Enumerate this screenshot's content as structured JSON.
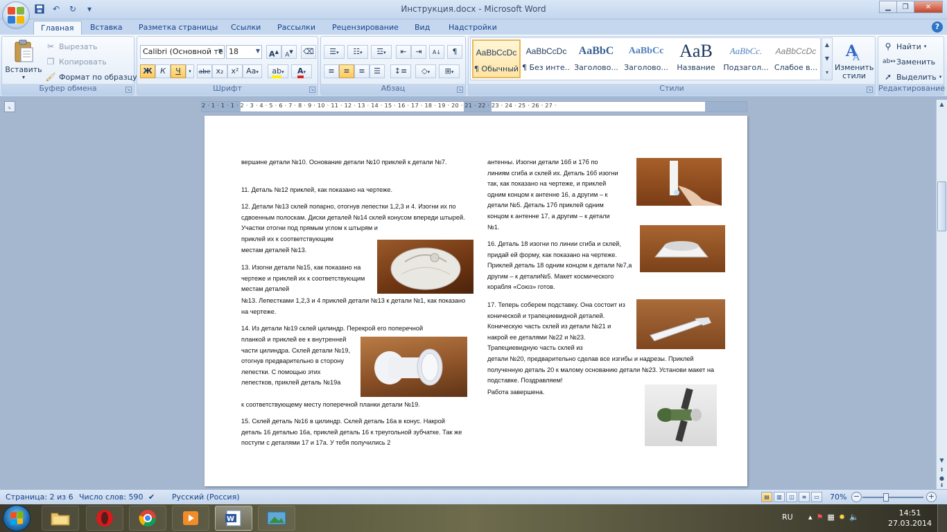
{
  "window": {
    "title": "Инструкция.docx - Microsoft Word"
  },
  "tabs": [
    "Главная",
    "Вставка",
    "Разметка страницы",
    "Ссылки",
    "Рассылки",
    "Рецензирование",
    "Вид",
    "Надстройки"
  ],
  "clipboard": {
    "paste": "Вставить",
    "cut": "Вырезать",
    "copy": "Копировать",
    "format_painter": "Формат по образцу",
    "label": "Буфер обмена"
  },
  "font": {
    "name": "Calibri (Основной те",
    "size": "18",
    "label": "Шрифт",
    "bold": "Ж",
    "italic": "К",
    "underline": "Ч",
    "strike": "abe",
    "subscript": "x₂",
    "superscript": "x²",
    "case": "Aa"
  },
  "paragraph": {
    "label": "Абзац"
  },
  "styles": {
    "label": "Стили",
    "change_styles": "Изменить стили",
    "items": [
      {
        "sample": "AaBbCcDc",
        "name": "¶ Обычный"
      },
      {
        "sample": "AaBbCcDc",
        "name": "¶ Без инте..."
      },
      {
        "sample": "AaBbC",
        "name": "Заголово..."
      },
      {
        "sample": "AaBbCc",
        "name": "Заголово..."
      },
      {
        "sample": "AaB",
        "name": "Название"
      },
      {
        "sample": "AaBbCc.",
        "name": "Подзагол..."
      },
      {
        "sample": "AaBbCcDc",
        "name": "Слабое в..."
      }
    ]
  },
  "editing": {
    "label": "Редактирование",
    "find": "Найти",
    "replace": "Заменить",
    "select": "Выделить"
  },
  "ruler": {
    "numbers": "2 · 1 · 1 · 1 · 2 · 3 · 4 · 5 · 6 · 7 · 8 · 9 · 10 · 11 · 12 · 13 · 14 · 15 · 16 · 17 · 18 · 19 · 20 · 21 · 22 · 23 · 24 · 25 · 26 · 27 ·"
  },
  "document": {
    "left_column": [
      "вершине детали №10. Основание детали №10 приклей к детали №7.",
      "11.  Деталь №12 приклей, как показано на чертеже.",
      "12. Детали №13 склей попарно, отогнув лепестки 1,2,3 и 4. Изогни их по сдвоенным полоскам. Диски деталей №14 склей конусом впереди штырей. Участки отогни под прямым углом к штырям и",
      "приклей их к соответствующим местам деталей №13.",
      "13. Изогни детали №15, как показано на чертеже и приклей их к соответствующим местам деталей",
      "№13. Лепестками 1,2,3 и 4 приклей детали №13 к детали №1, как показано на чертеже.",
      "14. Из детали №19 склей цилиндр. Перекрой его поперечной",
      "планкой и приклей ее к внутренней части цилиндра. Склей детали №19, отогнув предварительно в сторону лепестки. С помощью этих лепестков, приклей деталь №19а",
      "к соответствующему месту поперечной планки детали №19.",
      "15. Склей деталь №16 в цилиндр. Склей деталь 16а в конус. Накрой деталь 16 деталью 16а, приклей деталь 16 к треугольной зубчатке. Так же поступи с деталями  17 и 17а. У тебя получились 2"
    ],
    "right_column": [
      "антенны. Изогни детали 16б и 17б по линиям сгиба и склей их. Деталь 16б изогни так, как показано на чертеже, и приклей одним концом к антенне 16, а другим – к детали №5. Деталь 17б приклей одним концом к антенне 17, а другим – к детали №1.",
      "16. Деталь 18 изогни по линии сгиба и склей, придай ей форму, как показано на чертеже. Приклей деталь 18 одним концом к детали №7,а другим – к детали№5.  Макет космического корабля «Союз» готов.",
      "17. Теперь соберем подставку. Она состоит из конической и трапециевидной деталей. Коническую часть склей из детали №21 и накрой ее деталями №22 и №23. Трапециевидную часть склей из",
      "детали №20, предварительно сделав все изгибы и надрезы. Приклей полученную деталь 20 к малому  основанию детали  №23. Установи макет на подставке. Поздравляем!",
      "Работа завершена."
    ]
  },
  "statusbar": {
    "page": "Страница: 2 из 6",
    "words": "Число слов: 590",
    "language": "Русский (Россия)",
    "zoom": "70%"
  },
  "taskbar": {
    "lang": "RU",
    "time": "14:51",
    "date": "27.03.2014"
  },
  "colors": {
    "ribbon_blue": "#dbe7f6",
    "accent": "#15428b",
    "highlight": "#ffc85b"
  }
}
